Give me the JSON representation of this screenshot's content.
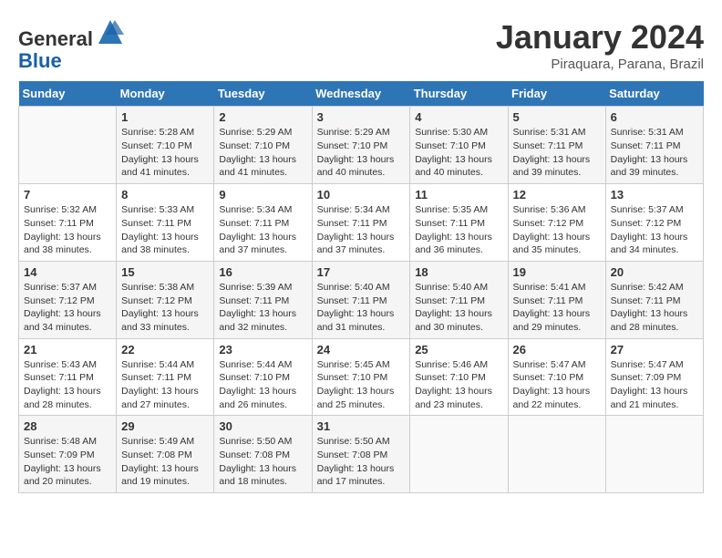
{
  "header": {
    "logo_line1": "General",
    "logo_line2": "Blue",
    "month": "January 2024",
    "location": "Piraquara, Parana, Brazil"
  },
  "weekdays": [
    "Sunday",
    "Monday",
    "Tuesday",
    "Wednesday",
    "Thursday",
    "Friday",
    "Saturday"
  ],
  "weeks": [
    [
      {
        "day": "",
        "info": ""
      },
      {
        "day": "1",
        "info": "Sunrise: 5:28 AM\nSunset: 7:10 PM\nDaylight: 13 hours\nand 41 minutes."
      },
      {
        "day": "2",
        "info": "Sunrise: 5:29 AM\nSunset: 7:10 PM\nDaylight: 13 hours\nand 41 minutes."
      },
      {
        "day": "3",
        "info": "Sunrise: 5:29 AM\nSunset: 7:10 PM\nDaylight: 13 hours\nand 40 minutes."
      },
      {
        "day": "4",
        "info": "Sunrise: 5:30 AM\nSunset: 7:10 PM\nDaylight: 13 hours\nand 40 minutes."
      },
      {
        "day": "5",
        "info": "Sunrise: 5:31 AM\nSunset: 7:11 PM\nDaylight: 13 hours\nand 39 minutes."
      },
      {
        "day": "6",
        "info": "Sunrise: 5:31 AM\nSunset: 7:11 PM\nDaylight: 13 hours\nand 39 minutes."
      }
    ],
    [
      {
        "day": "7",
        "info": "Sunrise: 5:32 AM\nSunset: 7:11 PM\nDaylight: 13 hours\nand 38 minutes."
      },
      {
        "day": "8",
        "info": "Sunrise: 5:33 AM\nSunset: 7:11 PM\nDaylight: 13 hours\nand 38 minutes."
      },
      {
        "day": "9",
        "info": "Sunrise: 5:34 AM\nSunset: 7:11 PM\nDaylight: 13 hours\nand 37 minutes."
      },
      {
        "day": "10",
        "info": "Sunrise: 5:34 AM\nSunset: 7:11 PM\nDaylight: 13 hours\nand 37 minutes."
      },
      {
        "day": "11",
        "info": "Sunrise: 5:35 AM\nSunset: 7:11 PM\nDaylight: 13 hours\nand 36 minutes."
      },
      {
        "day": "12",
        "info": "Sunrise: 5:36 AM\nSunset: 7:12 PM\nDaylight: 13 hours\nand 35 minutes."
      },
      {
        "day": "13",
        "info": "Sunrise: 5:37 AM\nSunset: 7:12 PM\nDaylight: 13 hours\nand 34 minutes."
      }
    ],
    [
      {
        "day": "14",
        "info": "Sunrise: 5:37 AM\nSunset: 7:12 PM\nDaylight: 13 hours\nand 34 minutes."
      },
      {
        "day": "15",
        "info": "Sunrise: 5:38 AM\nSunset: 7:12 PM\nDaylight: 13 hours\nand 33 minutes."
      },
      {
        "day": "16",
        "info": "Sunrise: 5:39 AM\nSunset: 7:11 PM\nDaylight: 13 hours\nand 32 minutes."
      },
      {
        "day": "17",
        "info": "Sunrise: 5:40 AM\nSunset: 7:11 PM\nDaylight: 13 hours\nand 31 minutes."
      },
      {
        "day": "18",
        "info": "Sunrise: 5:40 AM\nSunset: 7:11 PM\nDaylight: 13 hours\nand 30 minutes."
      },
      {
        "day": "19",
        "info": "Sunrise: 5:41 AM\nSunset: 7:11 PM\nDaylight: 13 hours\nand 29 minutes."
      },
      {
        "day": "20",
        "info": "Sunrise: 5:42 AM\nSunset: 7:11 PM\nDaylight: 13 hours\nand 28 minutes."
      }
    ],
    [
      {
        "day": "21",
        "info": "Sunrise: 5:43 AM\nSunset: 7:11 PM\nDaylight: 13 hours\nand 28 minutes."
      },
      {
        "day": "22",
        "info": "Sunrise: 5:44 AM\nSunset: 7:11 PM\nDaylight: 13 hours\nand 27 minutes."
      },
      {
        "day": "23",
        "info": "Sunrise: 5:44 AM\nSunset: 7:10 PM\nDaylight: 13 hours\nand 26 minutes."
      },
      {
        "day": "24",
        "info": "Sunrise: 5:45 AM\nSunset: 7:10 PM\nDaylight: 13 hours\nand 25 minutes."
      },
      {
        "day": "25",
        "info": "Sunrise: 5:46 AM\nSunset: 7:10 PM\nDaylight: 13 hours\nand 23 minutes."
      },
      {
        "day": "26",
        "info": "Sunrise: 5:47 AM\nSunset: 7:10 PM\nDaylight: 13 hours\nand 22 minutes."
      },
      {
        "day": "27",
        "info": "Sunrise: 5:47 AM\nSunset: 7:09 PM\nDaylight: 13 hours\nand 21 minutes."
      }
    ],
    [
      {
        "day": "28",
        "info": "Sunrise: 5:48 AM\nSunset: 7:09 PM\nDaylight: 13 hours\nand 20 minutes."
      },
      {
        "day": "29",
        "info": "Sunrise: 5:49 AM\nSunset: 7:08 PM\nDaylight: 13 hours\nand 19 minutes."
      },
      {
        "day": "30",
        "info": "Sunrise: 5:50 AM\nSunset: 7:08 PM\nDaylight: 13 hours\nand 18 minutes."
      },
      {
        "day": "31",
        "info": "Sunrise: 5:50 AM\nSunset: 7:08 PM\nDaylight: 13 hours\nand 17 minutes."
      },
      {
        "day": "",
        "info": ""
      },
      {
        "day": "",
        "info": ""
      },
      {
        "day": "",
        "info": ""
      }
    ]
  ]
}
